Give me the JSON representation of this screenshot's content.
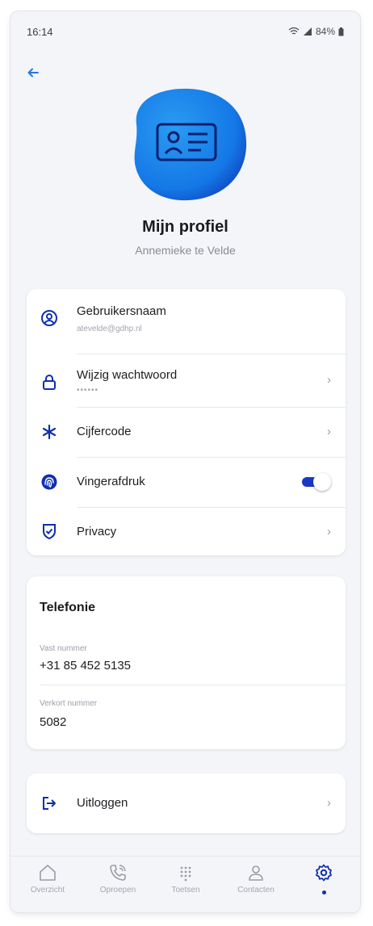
{
  "status_bar": {
    "time": "16:14",
    "battery": "84%"
  },
  "header": {
    "title": "Mijn profiel",
    "subtitle": "Annemieke te Velde"
  },
  "account": {
    "username_label": "Gebruikersnaam",
    "username_value": "atevelde@gdhp.nl",
    "password_label": "Wijzig wachtwoord",
    "password_value": "••••••",
    "pincode_label": "Cijfercode",
    "fingerprint_label": "Vingerafdruk",
    "fingerprint_enabled": true,
    "privacy_label": "Privacy"
  },
  "telephony": {
    "title": "Telefonie",
    "fixed_label": "Vast nummer",
    "fixed_value": "+31 85 452 5135",
    "short_label": "Verkort nummer",
    "short_value": "5082"
  },
  "logout": {
    "label": "Uitloggen"
  },
  "nav": {
    "items": [
      {
        "label": "Overzicht",
        "icon": "home-icon"
      },
      {
        "label": "Oproepen",
        "icon": "phone-icon"
      },
      {
        "label": "Toetsen",
        "icon": "dialpad-icon"
      },
      {
        "label": "Contacten",
        "icon": "person-icon"
      },
      {
        "label": "",
        "icon": "gear-icon",
        "active": true
      }
    ]
  },
  "colors": {
    "accent": "#0f2fb0",
    "blob": "#1e88ea",
    "background": "#f4f5f8"
  }
}
